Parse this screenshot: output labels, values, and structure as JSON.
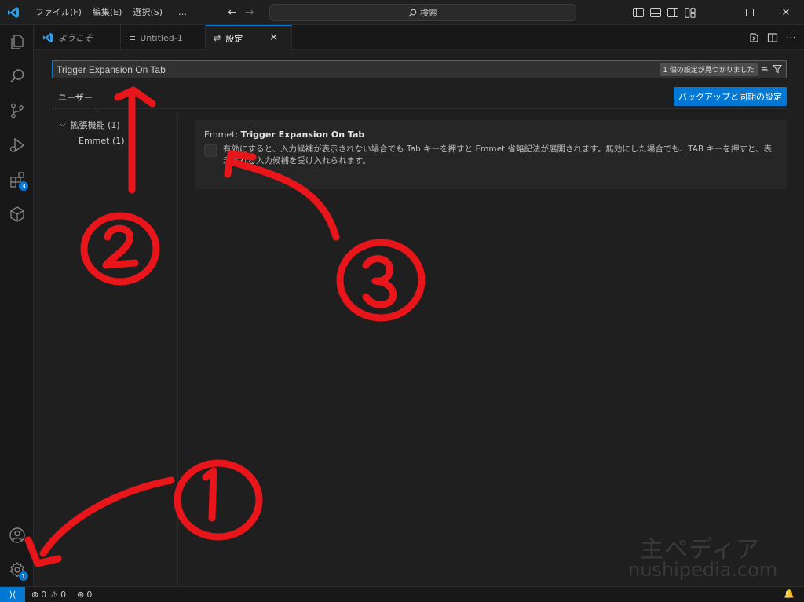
{
  "titlebar": {
    "menus": [
      "ファイル(F)",
      "編集(E)",
      "選択(S)",
      "…"
    ],
    "search_label": "検索",
    "window_controls": [
      "minimize",
      "maximize",
      "close"
    ]
  },
  "activity_bar": {
    "items": [
      "explorer-icon",
      "search-icon",
      "source-control-icon",
      "run-debug-icon",
      "extensions-icon",
      "remote-explorer-icon"
    ],
    "extensions_badge": "3",
    "accounts": "account-icon",
    "manage": "gear-icon",
    "manage_badge": "1"
  },
  "tabs": [
    {
      "label": "ようこそ",
      "icon": "vscode-icon",
      "active": false
    },
    {
      "label": "Untitled-1",
      "icon": "file-icon",
      "active": false
    },
    {
      "label": "設定",
      "icon": "settings-icon",
      "active": true
    }
  ],
  "settings": {
    "search_value": "Trigger Expansion On Tab",
    "result_count": "1 個の設定が見つかりました",
    "scope_tab": "ユーザー",
    "sync_button": "バックアップと同期の設定",
    "toc": [
      {
        "label": "拡張機能 (1)",
        "expanded": true
      },
      {
        "label": "Emmet (1)"
      }
    ],
    "setting": {
      "category": "Emmet: ",
      "name": "Trigger Expansion On Tab",
      "description": "有効にすると、入力候補が表示されない場合でも Tab キーを押すと Emmet 省略記法が展開されます。無効にした場合でも、TAB キーを押すと、表示される入力候補を受け入れられます。",
      "checked": false
    }
  },
  "statusbar": {
    "errors": "0",
    "warnings": "0",
    "ports": "0"
  },
  "watermark": {
    "line1": "主ペディア",
    "line2": "nushipedia.com"
  },
  "annotations": {
    "color": "#e8161b",
    "labels": [
      "①",
      "②",
      "③"
    ]
  },
  "colors": {
    "accent": "#0078d4",
    "background": "#1f1f1f",
    "sidebar": "#181818"
  }
}
